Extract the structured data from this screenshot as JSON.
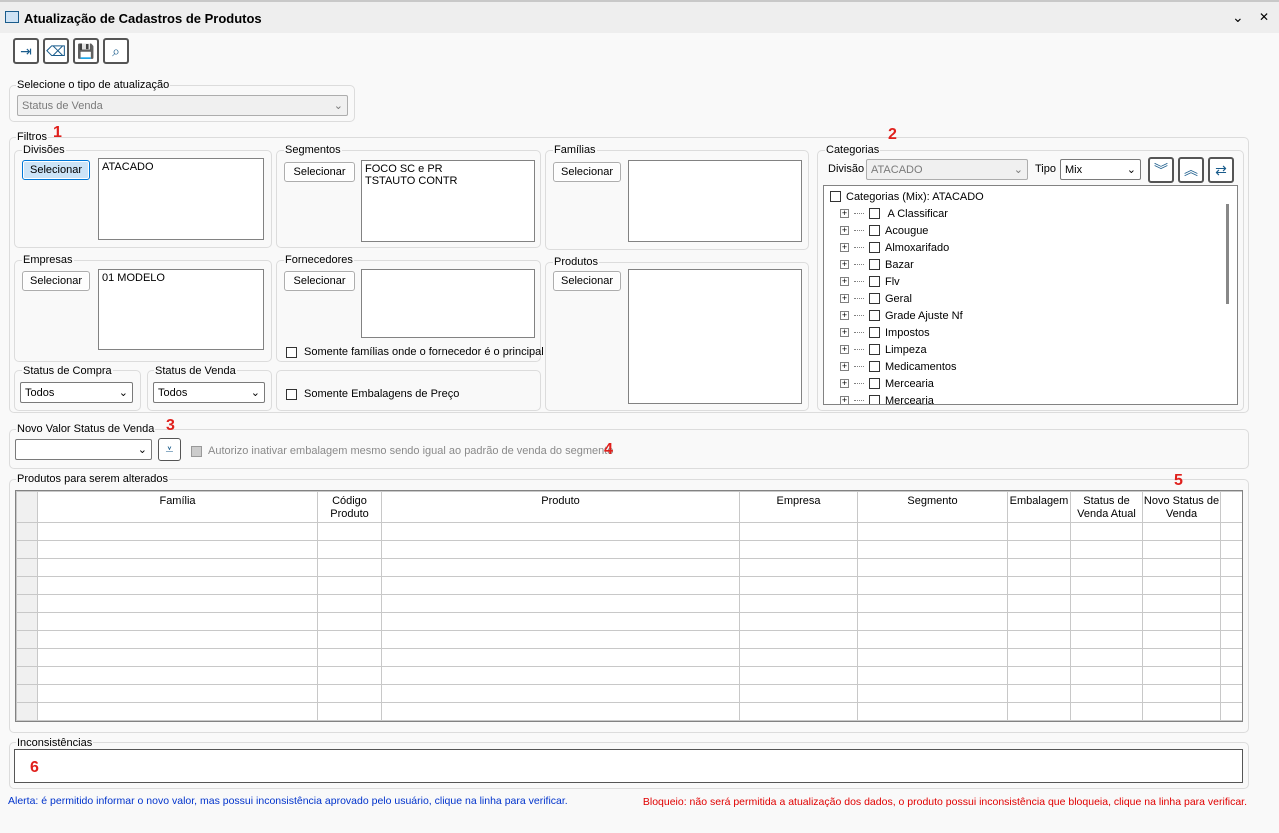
{
  "window": {
    "title": "Atualização de Cadastros de Produtos",
    "minimize": "⌄",
    "close": "✕"
  },
  "toolbar": [
    {
      "icon": "exit-icon",
      "glyph": "⇥"
    },
    {
      "icon": "eraser-icon",
      "glyph": "⌫"
    },
    {
      "icon": "save-icon",
      "glyph": "💾"
    },
    {
      "icon": "search-icon",
      "glyph": "⌕"
    }
  ],
  "update_type": {
    "label": "Selecione o tipo de atualização",
    "value": "Status de Venda"
  },
  "filters": {
    "label": "Filtros",
    "divisoes": {
      "label": "Divisões",
      "button": "Selecionar",
      "items": [
        "ATACADO"
      ]
    },
    "segmentos": {
      "label": "Segmentos",
      "button": "Selecionar",
      "items": [
        "FOCO SC e PR",
        "TSTAUTO CONTR"
      ]
    },
    "familias": {
      "label": "Famílias",
      "button": "Selecionar",
      "items": []
    },
    "empresas": {
      "label": "Empresas",
      "button": "Selecionar",
      "items": [
        "01 MODELO"
      ]
    },
    "fornecedores": {
      "label": "Fornecedores",
      "button": "Selecionar",
      "items": [],
      "checkbox": "Somente famílias onde o fornecedor é o principal"
    },
    "produtos": {
      "label": "Produtos",
      "button": "Selecionar",
      "items": []
    },
    "status_compra": {
      "label": "Status de Compra",
      "value": "Todos"
    },
    "status_venda": {
      "label": "Status de Venda",
      "value": "Todos"
    },
    "embalagens_checkbox": "Somente Embalagens de Preço"
  },
  "categorias": {
    "label": "Categorias",
    "divisao_label": "Divisão",
    "divisao_value": "ATACADO",
    "tipo_label": "Tipo",
    "tipo_value": "Mix",
    "root": "Categorias (Mix): ATACADO",
    "items": [
      " A Classificar",
      "Acougue",
      "Almoxarifado",
      "Bazar",
      "Flv",
      "Geral",
      "Grade Ajuste Nf",
      "Impostos",
      "Limpeza",
      "Medicamentos",
      "Mercearia",
      "Mercearia"
    ]
  },
  "novo_valor": {
    "label": "Novo Valor Status de Venda",
    "value": "",
    "checkbox": "Autorizo inativar embalagem mesmo sendo igual ao padrão de venda do segmento"
  },
  "grid": {
    "label": "Produtos para serem alterados",
    "columns": [
      "Família",
      "Código Produto",
      "Produto",
      "Empresa",
      "Segmento",
      "Embalagem",
      "Status de Venda Atual",
      "Novo Status de Venda"
    ],
    "row_count": 11
  },
  "inconsistencias": {
    "label": "Inconsistências"
  },
  "footer": {
    "alert": "Alerta: é permitido informar o novo valor, mas possui inconsistência aprovado pelo usuário, clique na linha para verificar.",
    "block": "Bloqueio: não será permitida a atualização dos dados, o produto possui inconsistência que bloqueia, clique na linha para verificar."
  },
  "markers": [
    "1",
    "2",
    "3",
    "4",
    "5",
    "6"
  ],
  "colors": {
    "alert": "#0033cc",
    "block": "#e00000",
    "marker": "#e0201c"
  }
}
